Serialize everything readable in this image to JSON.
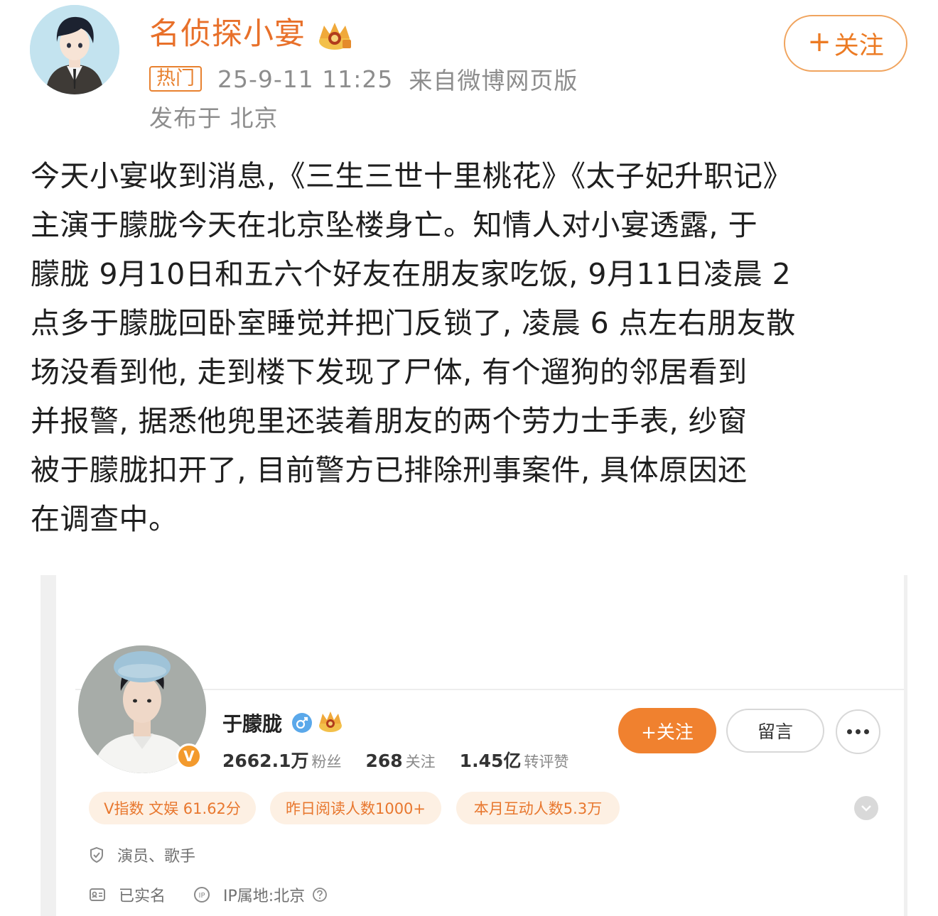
{
  "post": {
    "author": "名侦探小宴",
    "hot_badge": "热门",
    "timestamp": "25-9-11 11:25",
    "source": "来自微博网页版",
    "location": "发布于 北京",
    "follow_plus": "+",
    "follow_label": "关注",
    "lines": [
      "今天小宴收到消息,《三生三世十里桃花》《太子妃升职记》",
      "主演于朦胧今天在北京坠楼身亡。知情人对小宴透露, 于",
      "朦胧 9月10日和五六个好友在朋友家吃饭, 9月11日凌晨 2",
      "点多于朦胧回卧室睡觉并把门反锁了, 凌晨 6 点左右朋友散",
      "场没看到他, 走到楼下发现了尸体, 有个遛狗的邻居看到",
      "并报警, 据悉他兜里还装着朋友的两个劳力士手表, 纱窗",
      "被于朦胧扣开了, 目前警方已排除刑事案件, 具体原因还",
      "在调查中。"
    ]
  },
  "embedded_profile": {
    "name": "于朦胧",
    "v_badge": "V",
    "followers_num": "2662.1万",
    "followers_label": "粉丝",
    "following_num": "268",
    "following_label": "关注",
    "likes_num": "1.45亿",
    "likes_label": "转评赞",
    "follow_button": "+关注",
    "message_button": "留言",
    "pills": [
      "V指数 文娱 61.62分",
      "昨日阅读人数1000+",
      "本月互动人数5.3万"
    ],
    "occupation": "演员、歌手",
    "verified": "已实名",
    "ip_location": "IP属地:北京"
  },
  "colors": {
    "brand_orange": "#e8702a",
    "button_orange": "#f0812f",
    "pill_bg": "#fdf0e3",
    "meta_gray": "#8d8d8d"
  }
}
